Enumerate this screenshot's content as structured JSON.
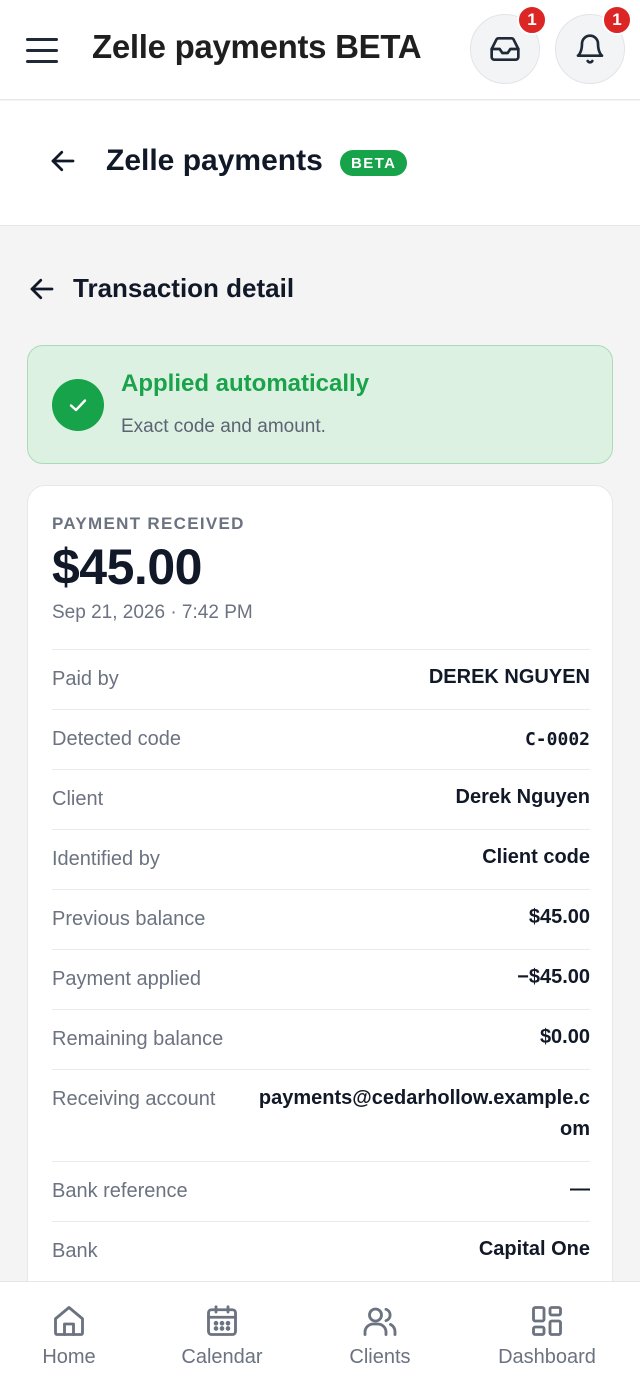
{
  "topbar": {
    "title": "Zelle payments BETA",
    "inbox_badge": "1",
    "notifications_badge": "1"
  },
  "subheader": {
    "title": "Zelle payments",
    "beta_label": "BETA"
  },
  "detail": {
    "title": "Transaction detail"
  },
  "status": {
    "title": "Applied automatically",
    "subtitle": "Exact code and amount."
  },
  "payment": {
    "label": "PAYMENT RECEIVED",
    "amount": "$45.00",
    "datetime": "Sep 21, 2026 · 7:42 PM",
    "rows": [
      {
        "label": "Paid by",
        "value": "DEREK NGUYEN"
      },
      {
        "label": "Detected code",
        "value": "C-0002"
      },
      {
        "label": "Client",
        "value": "Derek Nguyen"
      },
      {
        "label": "Identified by",
        "value": "Client code"
      },
      {
        "label": "Previous balance",
        "value": "$45.00"
      },
      {
        "label": "Payment applied",
        "value": "−$45.00"
      },
      {
        "label": "Remaining balance",
        "value": "$0.00"
      },
      {
        "label": "Receiving account",
        "value": "payments@cedarhollow.example.com"
      },
      {
        "label": "Bank reference",
        "value": "—"
      },
      {
        "label": "Bank",
        "value": "Capital One"
      }
    ]
  },
  "bottom_nav": {
    "items": [
      {
        "label": "Home",
        "icon": "home-icon"
      },
      {
        "label": "Calendar",
        "icon": "calendar-icon"
      },
      {
        "label": "Clients",
        "icon": "users-icon"
      },
      {
        "label": "Dashboard",
        "icon": "dashboard-icon"
      }
    ]
  },
  "colors": {
    "accent_green": "#16a34a",
    "badge_red": "#dc2626",
    "status_bg": "#ddf1e3"
  }
}
